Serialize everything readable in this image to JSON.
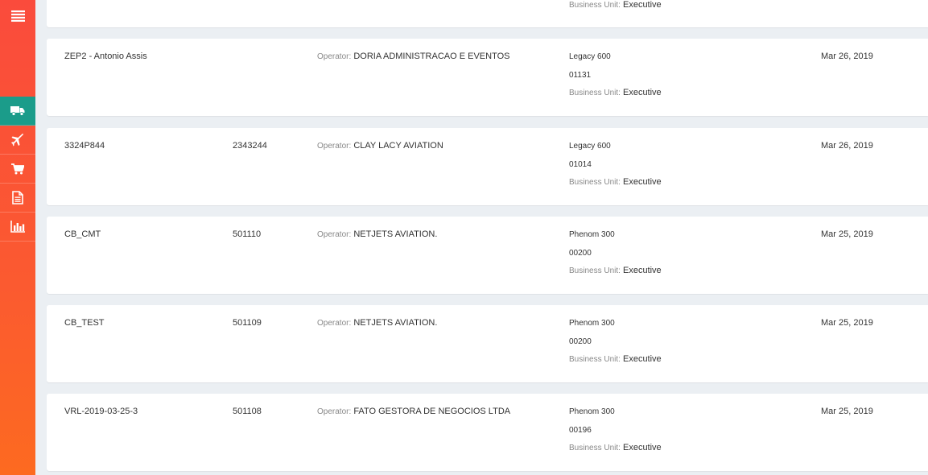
{
  "sidebar": {
    "menu_icon": "hamburger-icon",
    "items": [
      {
        "icon": "truck-icon",
        "active": true
      },
      {
        "icon": "plane-icon",
        "active": false
      },
      {
        "icon": "cart-icon",
        "active": false
      },
      {
        "icon": "document-icon",
        "active": false
      },
      {
        "icon": "bar-chart-icon",
        "active": false
      }
    ],
    "colors": {
      "gradient_top": "#fa4b3c",
      "gradient_bottom": "#fd6a20",
      "active": "#1b9c8a"
    }
  },
  "top_partial": {
    "business_unit_label": "Business Unit:",
    "business_unit": "Executive"
  },
  "labels": {
    "operator": "Operator:",
    "business_unit": "Business Unit:"
  },
  "rows": [
    {
      "name": "ZEP2 - Antonio Assis",
      "number": "",
      "operator": "DORIA ADMINISTRACAO E EVENTOS",
      "model": "Legacy 600",
      "serial": "01131",
      "business_unit": "Executive",
      "date": "Mar 26, 2019"
    },
    {
      "name": "3324P844",
      "number": "2343244",
      "operator": "CLAY LACY AVIATION",
      "model": "Legacy 600",
      "serial": "01014",
      "business_unit": "Executive",
      "date": "Mar 26, 2019"
    },
    {
      "name": "CB_CMT",
      "number": "501110",
      "operator": "NETJETS AVIATION.",
      "model": "Phenom 300",
      "serial": "00200",
      "business_unit": "Executive",
      "date": "Mar 25, 2019"
    },
    {
      "name": "CB_TEST",
      "number": "501109",
      "operator": "NETJETS AVIATION.",
      "model": "Phenom 300",
      "serial": "00200",
      "business_unit": "Executive",
      "date": "Mar 25, 2019"
    },
    {
      "name": "VRL-2019-03-25-3",
      "number": "501108",
      "operator": "FATO GESTORA DE NEGOCIOS LTDA",
      "model": "Phenom 300",
      "serial": "00196",
      "business_unit": "Executive",
      "date": "Mar 25, 2019"
    }
  ]
}
